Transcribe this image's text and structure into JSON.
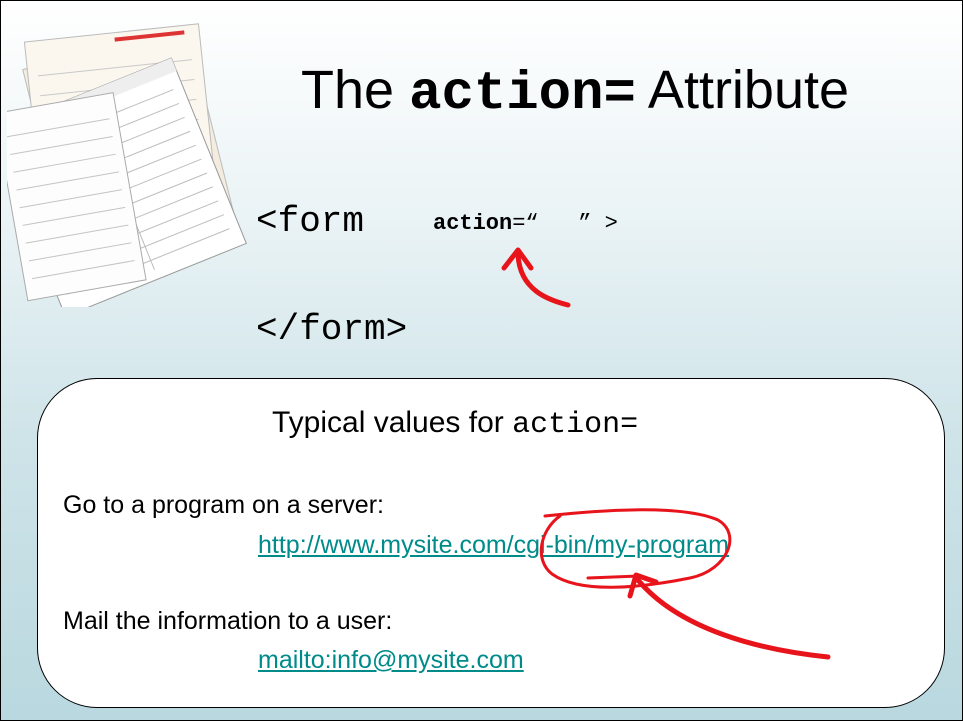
{
  "slide": {
    "title_prefix": "The ",
    "title_code": "action=",
    "title_suffix": " Attribute",
    "code_open": "<form",
    "code_attr_name": "action",
    "code_attr_rest": "=“   ” >",
    "code_close": "</form>"
  },
  "box": {
    "title_text": "Typical values for ",
    "title_code": "action=",
    "item1_label": "Go to a program on a server:",
    "item1_link": "http://www.mysite.com/cgi-bin/my-program",
    "item2_label": "Mail the information to a user:",
    "item2_link": "mailto:info@mysite.com"
  },
  "colors": {
    "link": "#008b8b",
    "annotation": "#e8141b"
  },
  "icons": {
    "forms_image": "stack-of-paper-forms"
  }
}
